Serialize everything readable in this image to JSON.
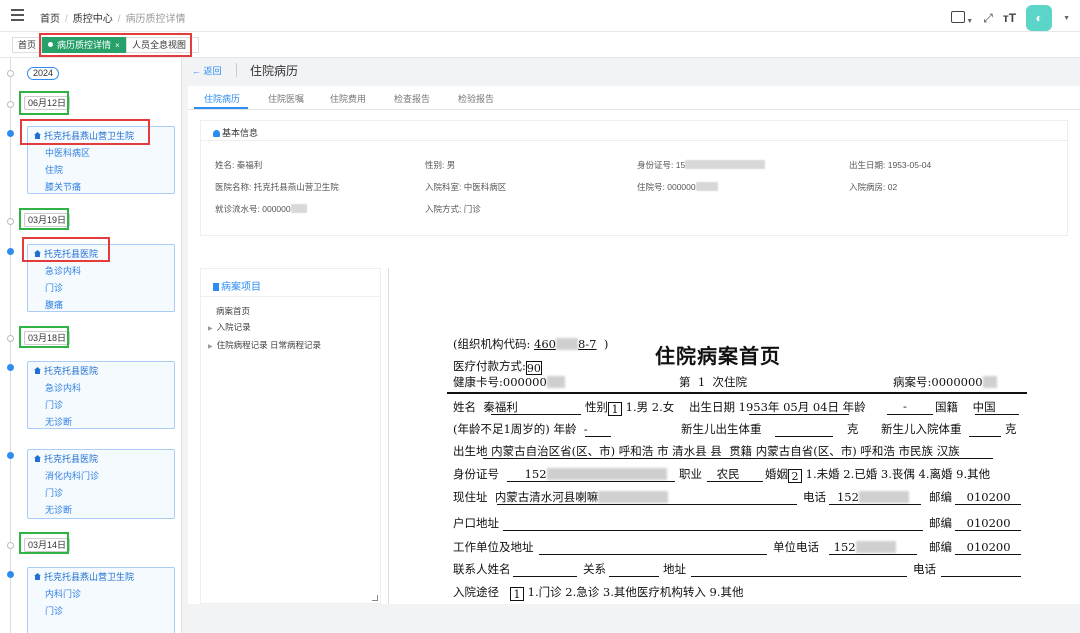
{
  "breadcrumb": {
    "home": "首页",
    "center": "质控中心",
    "current": "病历质控详情"
  },
  "tabs": [
    {
      "label": "首页"
    },
    {
      "label": "病历质控详情",
      "active": true
    },
    {
      "label": "人员全息视图"
    }
  ],
  "timeline": {
    "year": "2024",
    "dates": [
      "06月12日",
      "03月19日",
      "03月18日",
      "03月14日"
    ],
    "cards": [
      {
        "hospital": "托克托县燕山营卫生院",
        "lines": [
          "中医科病区",
          "住院",
          "膝关节痛"
        ]
      },
      {
        "hospital": "托克托县医院",
        "lines": [
          "急诊内科",
          "门诊",
          "腹痛"
        ]
      },
      {
        "hospital": "托克托县医院",
        "lines": [
          "急诊内科",
          "门诊",
          "无诊断"
        ]
      },
      {
        "hospital": "托克托县医院",
        "lines": [
          "消化内科门诊",
          "门诊",
          "无诊断"
        ]
      },
      {
        "hospital": "托克托县燕山营卫生院",
        "lines": [
          "内科门诊",
          "门诊"
        ]
      }
    ]
  },
  "page": {
    "back": "返回",
    "title": "住院病历"
  },
  "content_tabs": [
    "住院病历",
    "住院医嘱",
    "住院费用",
    "检查报告",
    "检验报告"
  ],
  "basic": {
    "header": "基本信息",
    "name_label": "姓名:",
    "name": "秦福利",
    "sex_label": "性别:",
    "sex": "男",
    "id_label": "身份证号:",
    "id_prefix": "15",
    "birth_label": "出生日期:",
    "birth": "1953-05-04",
    "hosp_label": "医院名称:",
    "hosp": "托克托县燕山营卫生院",
    "dept_label": "入院科室:",
    "dept": "中医科病区",
    "inpatient_label": "住院号:",
    "inpatient_prefix": "000000",
    "ward_label": "入院病房:",
    "ward": "02",
    "visit_label": "就诊流水号:",
    "visit_prefix": "000000",
    "mode_label": "入院方式:",
    "mode": "门诊"
  },
  "project": {
    "header": "病案项目",
    "items": [
      {
        "label": "病案首页",
        "arrow": false
      },
      {
        "label": "入院记录",
        "arrow": true
      },
      {
        "label": "住院病程记录 日常病程记录",
        "arrow": true
      }
    ]
  },
  "doc": {
    "org": "(组织机构代码:",
    "org_a": "460",
    "org_b": "8-7",
    "org_close": ")",
    "pay": "医疗付款方式:",
    "pay_val": "90",
    "title": "住院病案首页",
    "card": "健康卡号:000000",
    "times_a": "第",
    "times_n": "1",
    "times_b": "次住院",
    "caseno": "病案号:0000000",
    "r1_name_l": "姓名",
    "r1_name": "秦福利",
    "r1_sex_l": "性别",
    "r1_sex_v": "1",
    "r1_sex_opts": "1.男 2.女",
    "r1_birth_l": "出生日期",
    "r1_birth": "1953年 05月 04日",
    "r1_age_l": "年龄",
    "r1_age": "-",
    "r1_nat_l": "国籍",
    "r1_nat": "中国",
    "r2_a": "(年龄不足1周岁的) 年龄",
    "r2_av": "-",
    "r2_b": "新生儿出生体重",
    "r2_bu": "克",
    "r2_c": "新生儿入院体重",
    "r2_cu": "克",
    "r3_a": "出生地",
    "r3_av": "内蒙古自治区",
    "r3_b": "省(区、市)",
    "r3_bv": "呼和浩",
    "r3_c": "市",
    "r3_cv": "清水县",
    "r3_d": "县",
    "r3_e": "贯籍",
    "r3_ev": "内蒙古自",
    "r3_f": "省(区、市)",
    "r3_fv": "呼和浩",
    "r3_g": "市民族",
    "r3_gv": "汉族",
    "r4_a": "身份证号",
    "r4_av": "152",
    "r4_b": "职业",
    "r4_bv": "农民",
    "r4_c": "婚姻",
    "r4_cv": "2",
    "r4_copts": "1.未婚 2.已婚 3.丧偶 4.离婚 9.其他",
    "r5_a": "现住址",
    "r5_av": "内蒙古清水河县喇嘛",
    "r5_b": "电话",
    "r5_bv": "152",
    "r5_c": "邮编",
    "r5_cv": "010200",
    "r6_a": "户口地址",
    "r6_c": "邮编",
    "r6_cv": "010200",
    "r7_a": "工作单位及地址",
    "r7_b": "单位电话",
    "r7_bv": "152",
    "r7_c": "邮编",
    "r7_cv": "010200",
    "r8_a": "联系人姓名",
    "r8_b": "关系",
    "r8_c": "地址",
    "r8_d": "电话",
    "r9_a": "入院途径",
    "r9_v": "1",
    "r9_opts": "1.门诊 2.急诊 3.其他医疗机构转入 9.其他"
  }
}
